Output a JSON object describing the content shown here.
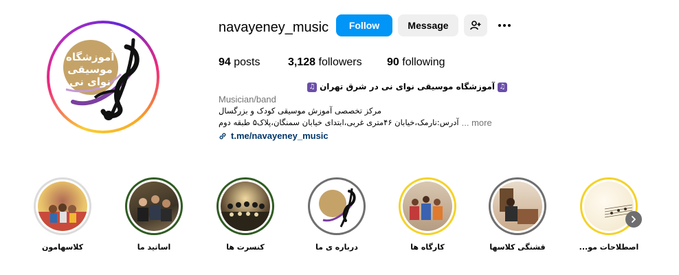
{
  "profile": {
    "username": "navayeney_music",
    "avatar_logo_text": "آموزشگاه موسیقی نوای نی"
  },
  "actions": {
    "follow_label": "Follow",
    "message_label": "Message",
    "add_user_icon": "person-add-icon",
    "more_icon": "more-dots-icon"
  },
  "stats": {
    "posts_count": "94",
    "posts_label": "posts",
    "followers_count": "3,128",
    "followers_label": "followers",
    "following_count": "90",
    "following_label": "following"
  },
  "bio": {
    "name": "آموزشگاه موسیقی نوای نی در شرق تهران",
    "category": "Musician/band",
    "line1": "مرکز تخصصی آموزش موسیقی کودک و بزرگسال",
    "line2": "آدرس:نارمک،خیابان ۴۶متری غربی،ابتدای خیابان سمنگان،پلاک۵ طبقه دوم",
    "more_label": "... more",
    "link": "t.me/navayeney_music"
  },
  "highlights": [
    {
      "label": "کلاسهامون"
    },
    {
      "label": "اساتید ما"
    },
    {
      "label": "کنسرت ها"
    },
    {
      "label": "درباره ی ما"
    },
    {
      "label": "کارگاه ها"
    },
    {
      "label": "قشنگی کلاسها"
    },
    {
      "label": "اصطلاحات مو..."
    }
  ],
  "colors": {
    "follow_blue": "#0095f6",
    "button_gray": "#efefef",
    "link_blue": "#00376b",
    "secondary_text": "#737373",
    "highlight_yellow": "#f4d22a",
    "highlight_green": "#2f5c22"
  }
}
